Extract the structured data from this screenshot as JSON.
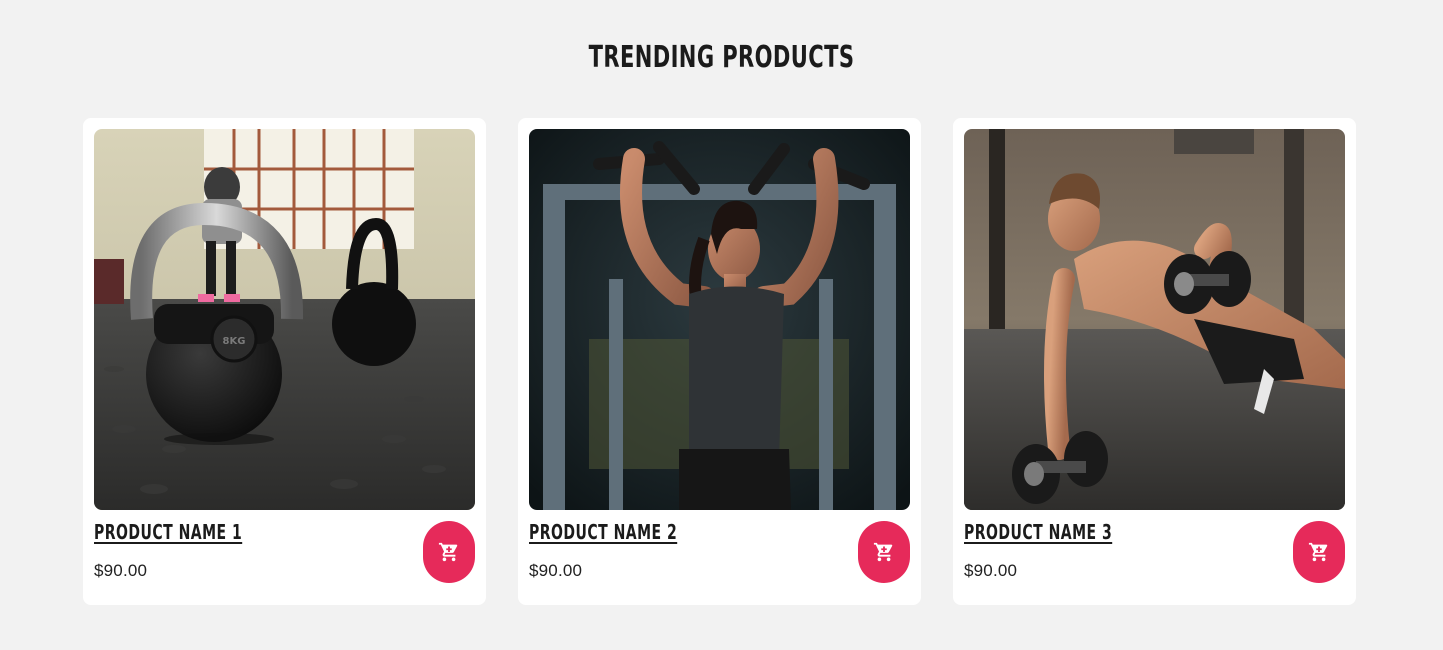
{
  "section": {
    "title": "TRENDING PRODUCTS"
  },
  "products": [
    {
      "name": "PRODUCT NAME 1",
      "price": "$90.00",
      "image": "kettlebell-gym-photo",
      "cart_icon": "cart-icon"
    },
    {
      "name": "PRODUCT NAME 2",
      "price": "$90.00",
      "image": "woman-pullup-photo",
      "cart_icon": "cart-icon"
    },
    {
      "name": "PRODUCT NAME 3",
      "price": "$90.00",
      "image": "man-dumbbell-pushup-photo",
      "cart_icon": "cart-icon"
    }
  ],
  "colors": {
    "background": "#f2f2f2",
    "card": "#ffffff",
    "accent": "#e62a5a",
    "text": "#1b1b1b"
  }
}
